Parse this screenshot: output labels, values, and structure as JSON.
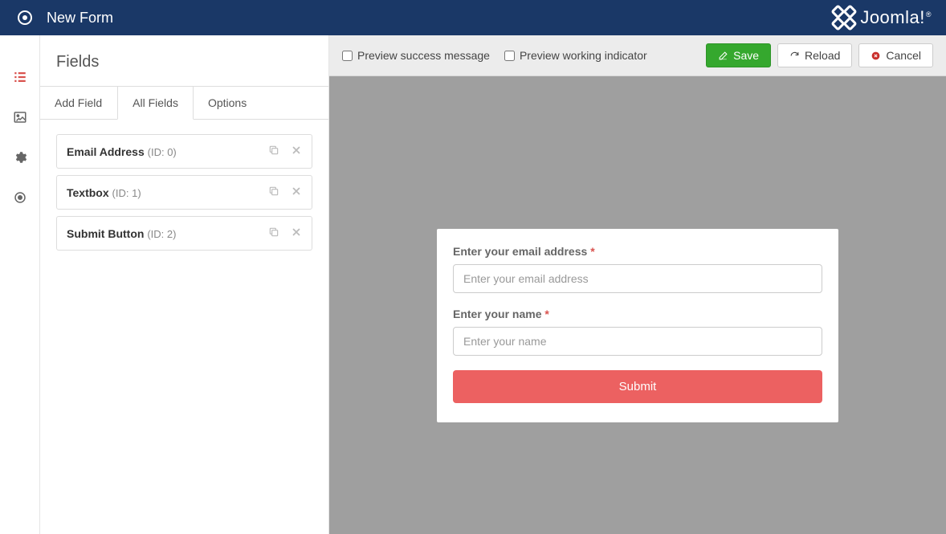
{
  "header": {
    "title": "New Form",
    "brand": "Joomla!"
  },
  "sidebar": {
    "title": "Fields",
    "tabs": {
      "add": "Add Field",
      "all": "All Fields",
      "options": "Options"
    },
    "fields": [
      {
        "name": "Email Address",
        "id_label": "(ID: 0)"
      },
      {
        "name": "Textbox",
        "id_label": "(ID: 1)"
      },
      {
        "name": "Submit Button",
        "id_label": "(ID: 2)"
      }
    ]
  },
  "toolbar": {
    "preview_success": "Preview success message",
    "preview_working": "Preview working indicator",
    "save": "Save",
    "reload": "Reload",
    "cancel": "Cancel"
  },
  "form": {
    "email": {
      "label": "Enter your email address",
      "placeholder": "Enter your email address"
    },
    "name": {
      "label": "Enter your name",
      "placeholder": "Enter your name"
    },
    "submit": "Submit"
  },
  "vnav_icons": [
    "list-icon",
    "image-icon",
    "gear-icon",
    "target-icon"
  ]
}
